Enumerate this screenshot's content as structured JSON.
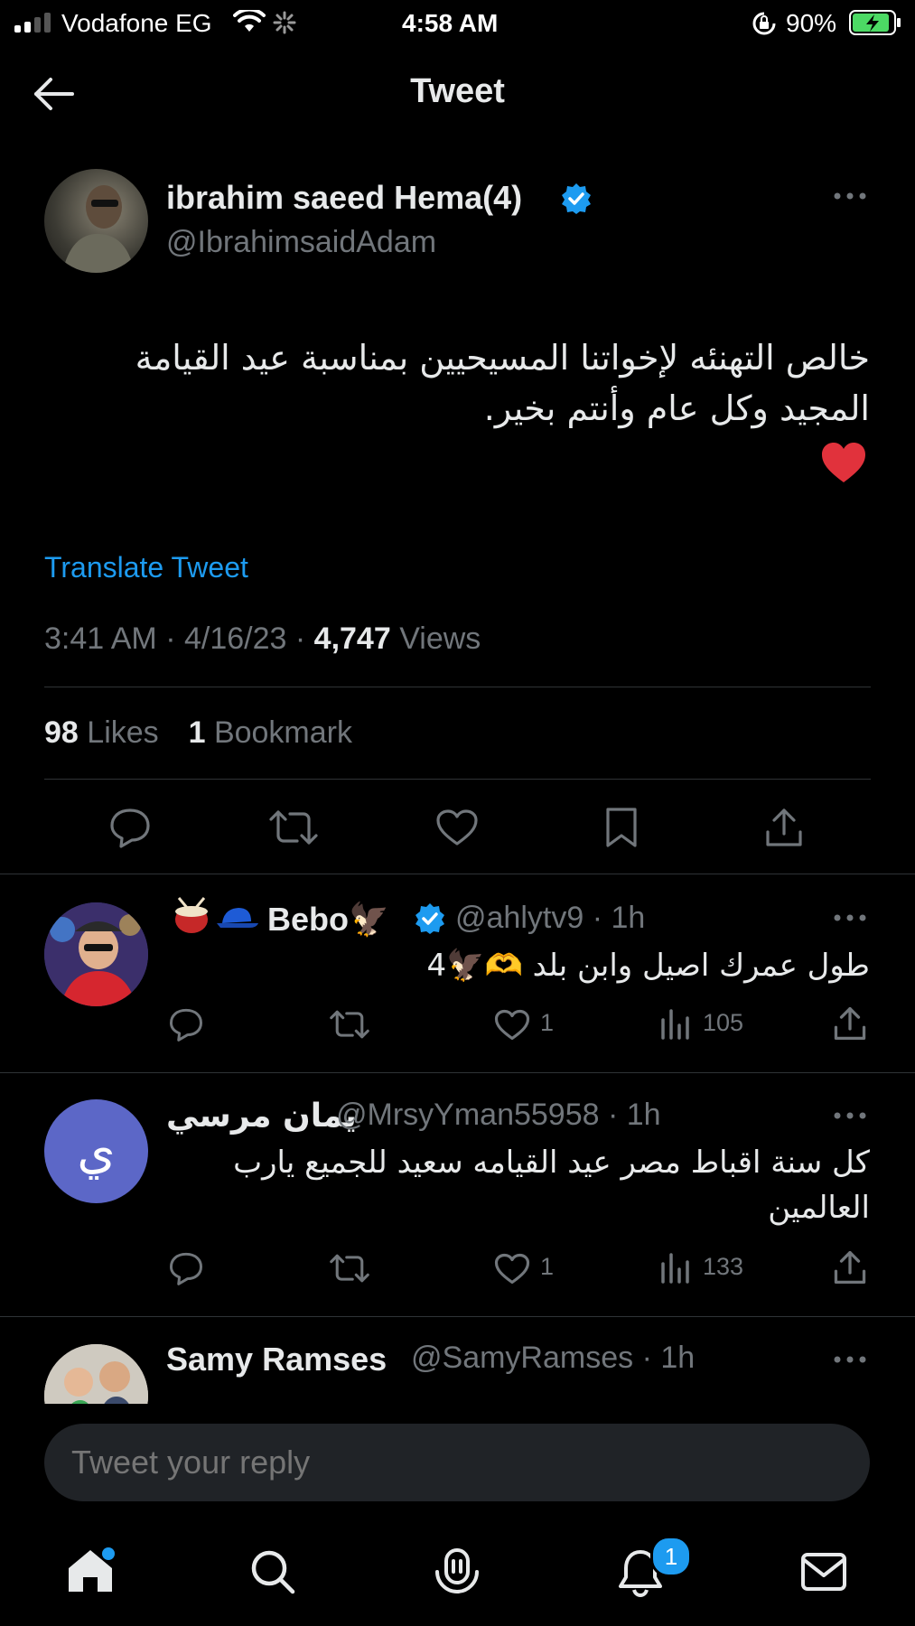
{
  "status_bar": {
    "carrier": "Vodafone EG",
    "time": "4:58 AM",
    "battery": "90%"
  },
  "header": {
    "title": "Tweet"
  },
  "main_tweet": {
    "author_name": "ibrahim saeed Hema(4)",
    "handle": "@IbrahimsaidAdam",
    "text_line1": "خالص التهنئه لإخواتنا المسيحيين بمناسبة عيد القيامة",
    "text_line2": "المجيد وكل عام وأنتم بخير.",
    "emoji": "❤️",
    "translate_label": "Translate Tweet",
    "time": "3:41 AM",
    "date": "4/16/23",
    "views_count": "4,747",
    "views_label": "Views",
    "likes_count": "98",
    "likes_label": "Likes",
    "bookmarks_count": "1",
    "bookmarks_label": "Bookmark"
  },
  "replies": [
    {
      "name_prefix": "🥁 🧢",
      "name": "Bebo🦅",
      "verified": true,
      "handle": "@ahlytv9",
      "age": "1h",
      "text_lines": [
        "طول عمرك اصيل وابن بلد 🫶🦅4"
      ],
      "likes": "1",
      "views": "105"
    },
    {
      "name": "يمان مرسي",
      "verified": false,
      "handle": "@MrsyYman55958",
      "age": "1h",
      "avatar_letter": "ي",
      "text_lines": [
        "كل سنة اقباط مصر عيد القيامه سعيد للجميع يارب",
        "العالمين"
      ],
      "likes": "1",
      "views": "133"
    },
    {
      "name": "Samy Ramses",
      "verified": false,
      "handle": "@SamyRamses",
      "age": "1h"
    }
  ],
  "composer": {
    "placeholder": "Tweet your reply"
  },
  "tab_bar": {
    "notifications_badge": "1"
  },
  "colors": {
    "accent": "#1d9bf0",
    "background": "#000000",
    "muted": "#71767b",
    "divider": "#2f3336",
    "badge_avatar": "#5c67c7"
  }
}
